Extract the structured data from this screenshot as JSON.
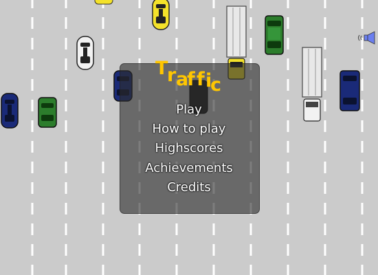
{
  "game": {
    "title": "Traffic",
    "title_letters": [
      "T",
      "r",
      "a",
      "f",
      "f",
      "i",
      "c"
    ],
    "title_color": "#ffc600"
  },
  "menu": {
    "items": [
      "Play",
      "How to play",
      "Highscores",
      "Achievements",
      "Credits"
    ],
    "text_color": "#ffffff"
  },
  "colors": {
    "road": "#cbcbcb",
    "lane_marking": "#ffffff",
    "panel": "rgba(45,45,45,0.62)",
    "car_yellow": "#f4e22a",
    "car_white": "#f2f2f2",
    "car_blue": "#1a2a78",
    "car_green": "#2c7d2c",
    "truck_trailer": "#e8e8e8",
    "sound_icon": "#6b7ff0"
  },
  "icons": {
    "sound": "speaker-icon"
  }
}
